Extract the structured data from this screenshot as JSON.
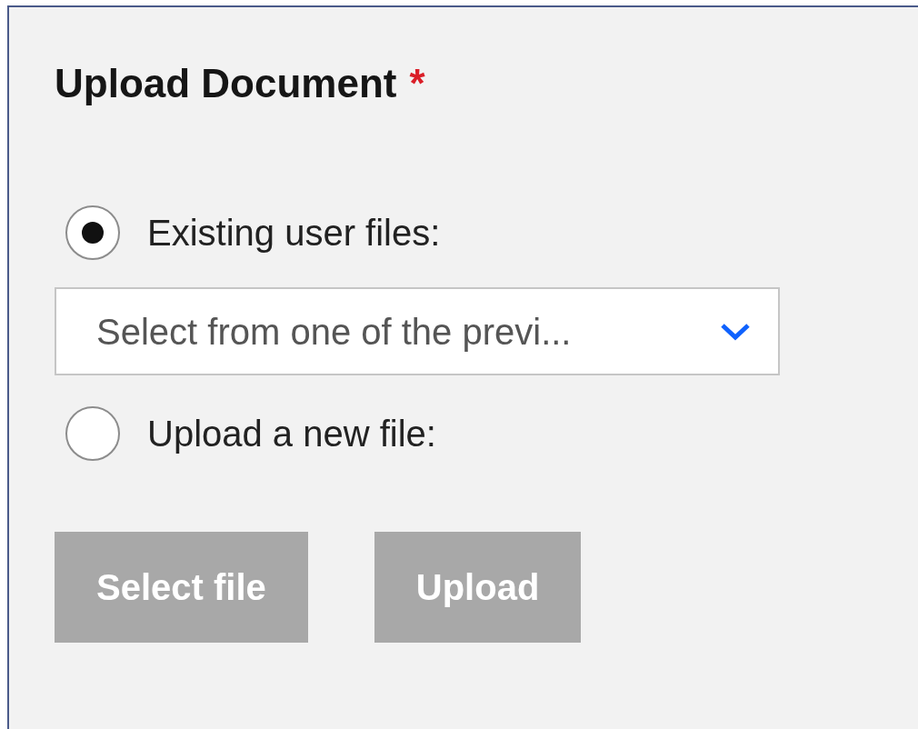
{
  "title": "Upload Document",
  "required_mark": "*",
  "options": [
    {
      "label": "Existing user files:",
      "selected": true
    },
    {
      "label": "Upload a new file:",
      "selected": false
    }
  ],
  "dropdown": {
    "value": "Select from one of the previ..."
  },
  "buttons": [
    {
      "label": "Select file",
      "disabled": true
    },
    {
      "label": "Upload",
      "disabled": true
    }
  ]
}
